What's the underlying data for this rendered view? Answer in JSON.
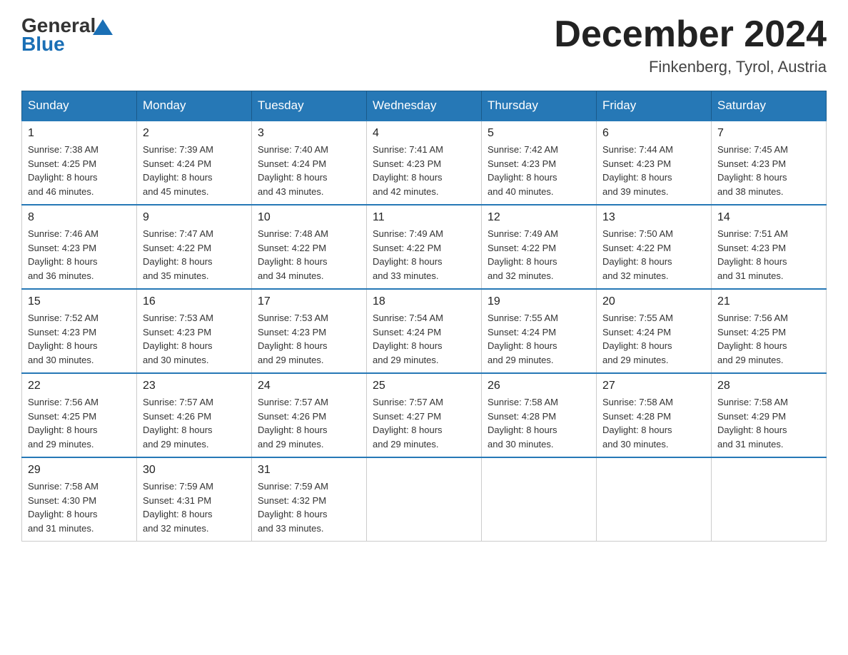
{
  "logo": {
    "general": "General",
    "blue": "Blue"
  },
  "title": {
    "month_year": "December 2024",
    "location": "Finkenberg, Tyrol, Austria"
  },
  "headers": [
    "Sunday",
    "Monday",
    "Tuesday",
    "Wednesday",
    "Thursday",
    "Friday",
    "Saturday"
  ],
  "weeks": [
    [
      {
        "day": "1",
        "sunrise": "7:38 AM",
        "sunset": "4:25 PM",
        "daylight": "8 hours and 46 minutes."
      },
      {
        "day": "2",
        "sunrise": "7:39 AM",
        "sunset": "4:24 PM",
        "daylight": "8 hours and 45 minutes."
      },
      {
        "day": "3",
        "sunrise": "7:40 AM",
        "sunset": "4:24 PM",
        "daylight": "8 hours and 43 minutes."
      },
      {
        "day": "4",
        "sunrise": "7:41 AM",
        "sunset": "4:23 PM",
        "daylight": "8 hours and 42 minutes."
      },
      {
        "day": "5",
        "sunrise": "7:42 AM",
        "sunset": "4:23 PM",
        "daylight": "8 hours and 40 minutes."
      },
      {
        "day": "6",
        "sunrise": "7:44 AM",
        "sunset": "4:23 PM",
        "daylight": "8 hours and 39 minutes."
      },
      {
        "day": "7",
        "sunrise": "7:45 AM",
        "sunset": "4:23 PM",
        "daylight": "8 hours and 38 minutes."
      }
    ],
    [
      {
        "day": "8",
        "sunrise": "7:46 AM",
        "sunset": "4:23 PM",
        "daylight": "8 hours and 36 minutes."
      },
      {
        "day": "9",
        "sunrise": "7:47 AM",
        "sunset": "4:22 PM",
        "daylight": "8 hours and 35 minutes."
      },
      {
        "day": "10",
        "sunrise": "7:48 AM",
        "sunset": "4:22 PM",
        "daylight": "8 hours and 34 minutes."
      },
      {
        "day": "11",
        "sunrise": "7:49 AM",
        "sunset": "4:22 PM",
        "daylight": "8 hours and 33 minutes."
      },
      {
        "day": "12",
        "sunrise": "7:49 AM",
        "sunset": "4:22 PM",
        "daylight": "8 hours and 32 minutes."
      },
      {
        "day": "13",
        "sunrise": "7:50 AM",
        "sunset": "4:22 PM",
        "daylight": "8 hours and 32 minutes."
      },
      {
        "day": "14",
        "sunrise": "7:51 AM",
        "sunset": "4:23 PM",
        "daylight": "8 hours and 31 minutes."
      }
    ],
    [
      {
        "day": "15",
        "sunrise": "7:52 AM",
        "sunset": "4:23 PM",
        "daylight": "8 hours and 30 minutes."
      },
      {
        "day": "16",
        "sunrise": "7:53 AM",
        "sunset": "4:23 PM",
        "daylight": "8 hours and 30 minutes."
      },
      {
        "day": "17",
        "sunrise": "7:53 AM",
        "sunset": "4:23 PM",
        "daylight": "8 hours and 29 minutes."
      },
      {
        "day": "18",
        "sunrise": "7:54 AM",
        "sunset": "4:24 PM",
        "daylight": "8 hours and 29 minutes."
      },
      {
        "day": "19",
        "sunrise": "7:55 AM",
        "sunset": "4:24 PM",
        "daylight": "8 hours and 29 minutes."
      },
      {
        "day": "20",
        "sunrise": "7:55 AM",
        "sunset": "4:24 PM",
        "daylight": "8 hours and 29 minutes."
      },
      {
        "day": "21",
        "sunrise": "7:56 AM",
        "sunset": "4:25 PM",
        "daylight": "8 hours and 29 minutes."
      }
    ],
    [
      {
        "day": "22",
        "sunrise": "7:56 AM",
        "sunset": "4:25 PM",
        "daylight": "8 hours and 29 minutes."
      },
      {
        "day": "23",
        "sunrise": "7:57 AM",
        "sunset": "4:26 PM",
        "daylight": "8 hours and 29 minutes."
      },
      {
        "day": "24",
        "sunrise": "7:57 AM",
        "sunset": "4:26 PM",
        "daylight": "8 hours and 29 minutes."
      },
      {
        "day": "25",
        "sunrise": "7:57 AM",
        "sunset": "4:27 PM",
        "daylight": "8 hours and 29 minutes."
      },
      {
        "day": "26",
        "sunrise": "7:58 AM",
        "sunset": "4:28 PM",
        "daylight": "8 hours and 30 minutes."
      },
      {
        "day": "27",
        "sunrise": "7:58 AM",
        "sunset": "4:28 PM",
        "daylight": "8 hours and 30 minutes."
      },
      {
        "day": "28",
        "sunrise": "7:58 AM",
        "sunset": "4:29 PM",
        "daylight": "8 hours and 31 minutes."
      }
    ],
    [
      {
        "day": "29",
        "sunrise": "7:58 AM",
        "sunset": "4:30 PM",
        "daylight": "8 hours and 31 minutes."
      },
      {
        "day": "30",
        "sunrise": "7:59 AM",
        "sunset": "4:31 PM",
        "daylight": "8 hours and 32 minutes."
      },
      {
        "day": "31",
        "sunrise": "7:59 AM",
        "sunset": "4:32 PM",
        "daylight": "8 hours and 33 minutes."
      },
      null,
      null,
      null,
      null
    ]
  ],
  "labels": {
    "sunrise": "Sunrise:",
    "sunset": "Sunset:",
    "daylight": "Daylight:"
  }
}
